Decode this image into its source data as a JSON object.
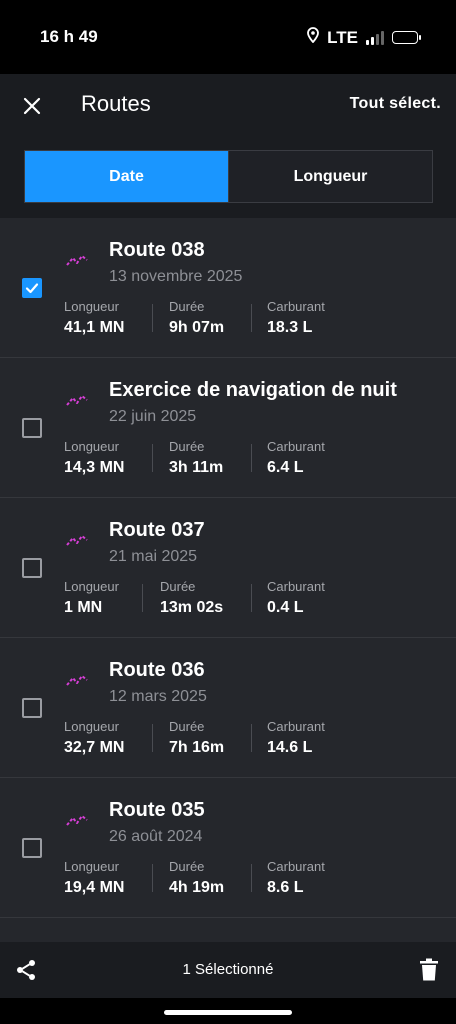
{
  "status_bar": {
    "time": "16 h 49",
    "network": "LTE"
  },
  "header": {
    "title": "Routes",
    "select_all": "Tout sélect.",
    "segments": [
      {
        "label": "Date",
        "active": true
      },
      {
        "label": "Longueur",
        "active": false
      }
    ]
  },
  "stat_labels": {
    "length": "Longueur",
    "duration": "Durée",
    "fuel": "Carburant"
  },
  "routes": [
    {
      "name": "Route 038",
      "date": "13 novembre 2025",
      "length": "41,1 MN",
      "duration": "9h 07m",
      "fuel": "18.3 L",
      "checked": true
    },
    {
      "name": "Exercice de navigation de nuit",
      "date": "22 juin 2025",
      "length": "14,3 MN",
      "duration": "3h 11m",
      "fuel": "6.4 L",
      "checked": false
    },
    {
      "name": "Route 037",
      "date": "21 mai 2025",
      "length": "1 MN",
      "duration": "13m 02s",
      "fuel": "0.4 L",
      "checked": false
    },
    {
      "name": "Route 036",
      "date": "12 mars 2025",
      "length": "32,7 MN",
      "duration": "7h 16m",
      "fuel": "14.6 L",
      "checked": false
    },
    {
      "name": "Route 035",
      "date": "26 août 2024",
      "length": "19,4 MN",
      "duration": "4h 19m",
      "fuel": "8.6 L",
      "checked": false
    }
  ],
  "bottom_bar": {
    "selected_count": "1 Sélectionné"
  },
  "colors": {
    "accent": "#1a96ff",
    "route_icon": "#d63fd6",
    "background": "#25272c",
    "header": "#1a1c20"
  },
  "icons": [
    "close-icon",
    "route-icon",
    "check-icon",
    "share-icon",
    "trash-icon",
    "location-icon",
    "signal-icon",
    "battery-icon"
  ]
}
